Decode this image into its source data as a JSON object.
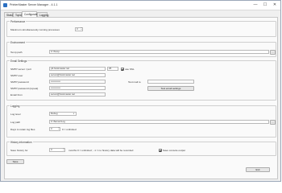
{
  "window": {
    "title": "PrinterMaster Server Manager - 4.1.1",
    "min_glyph": "—",
    "max_glyph": "☐",
    "close_glyph": "✕"
  },
  "tabs": [
    {
      "label": "Status"
    },
    {
      "label": "Topics"
    },
    {
      "label": "Configuration"
    },
    {
      "label": "Logging"
    }
  ],
  "performance": {
    "title": "Performance",
    "max_label": "Maximum simultaneously running processes",
    "max_value": "3"
  },
  "environment": {
    "title": "Environment",
    "temp_label": "Temp path",
    "temp_value": "C:\\Temp",
    "browse_label": "..."
  },
  "email": {
    "title": "Email Settings",
    "smtp_server_label": "SMTP server / port",
    "smtp_server_value": "p3.hostmaster.net",
    "smtp_port_value": "25",
    "ssl_label": "use SSL",
    "smtp_user_label": "SMTP user",
    "smtp_user_value": "server@hostmaster.net",
    "smtp_password_label": "SMTP password",
    "smtp_password_value": "••••••••••••",
    "smtp_password_repeat_label": "SMTP password (repeat)",
    "smtp_password_repeat_value": "••••••••••••",
    "email_from_label": "Email from",
    "email_from_value": "server@hostmaster.net",
    "test_mail_label": "Test mail to",
    "test_mail_value": "",
    "test_button_label": "Test email settings"
  },
  "logging": {
    "title": "Logging",
    "level_label": "Log level",
    "level_value": "Debug",
    "path_label": "Log path",
    "path_value": "C:\\Server\\Log",
    "browse_label": "...",
    "days_label": "Days to retain log files",
    "days_value": "3",
    "days_hint": "0 = unlimited"
  },
  "history": {
    "title": "History information",
    "save_label": "Save history for",
    "save_value": "3",
    "months_hint": "months  0 = unlimited ; -1 = no history data will be recorded",
    "console_label": "Save console output"
  },
  "buttons": {
    "save": "Save",
    "exit": "Exit"
  }
}
